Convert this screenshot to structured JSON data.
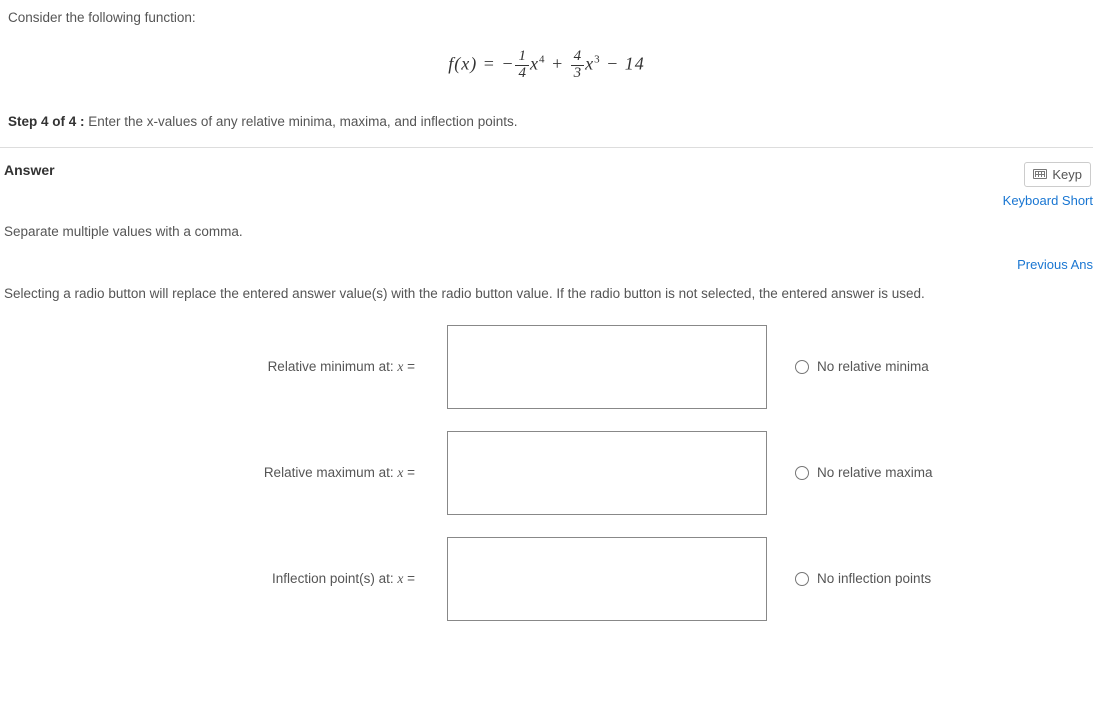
{
  "question": {
    "intro": "Consider the following function:",
    "equation_lhs": "f(x) = ",
    "equation_parts": {
      "minus1": "−",
      "frac1_num": "1",
      "frac1_den": "4",
      "x4": "x",
      "sup4": "4",
      "plus": " + ",
      "frac2_num": "4",
      "frac2_den": "3",
      "x3": "x",
      "sup3": "3",
      "minus14": " − 14"
    },
    "step_label": "Step 4 of 4 :",
    "step_text": "  Enter the x-values of any relative minima, maxima, and inflection points."
  },
  "answer_section": {
    "answer_label": "Answer",
    "keyp_label": "Keyp",
    "keyboard_shortcut": "Keyboard Short",
    "separate_instruction": "Separate multiple values with a comma.",
    "previous_ans": "Previous Ans",
    "radio_instruction": "Selecting a radio button will replace the entered answer value(s) with the radio button value. If the radio button is not selected, the entered answer is used."
  },
  "rows": [
    {
      "label_prefix": "Relative minimum at: ",
      "label_var": "x",
      "label_suffix": " =",
      "radio_label": "No relative minima"
    },
    {
      "label_prefix": "Relative maximum at: ",
      "label_var": "x",
      "label_suffix": " =",
      "radio_label": "No relative maxima"
    },
    {
      "label_prefix": "Inflection point(s) at: ",
      "label_var": "x",
      "label_suffix": " =",
      "radio_label": "No inflection points"
    }
  ]
}
